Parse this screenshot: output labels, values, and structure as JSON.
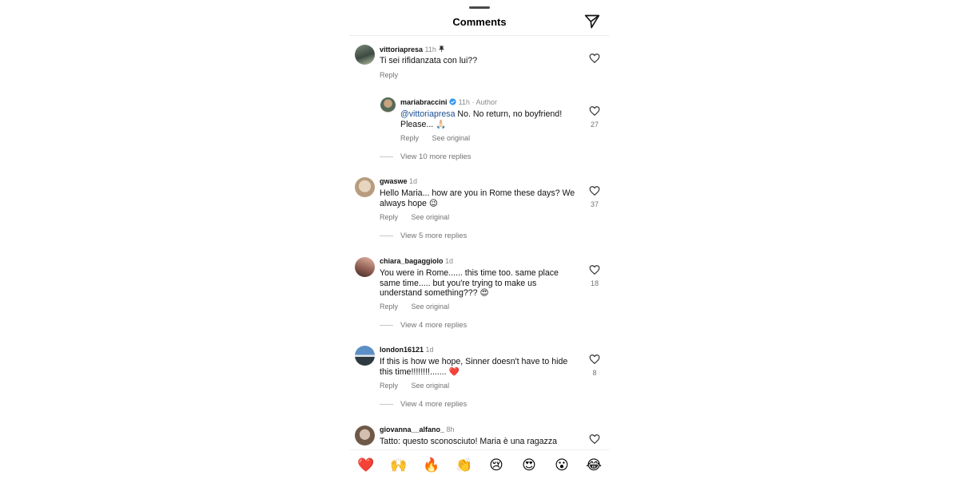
{
  "header": {
    "title": "Comments",
    "send_icon": "paper-plane-icon"
  },
  "comments": [
    {
      "user": "vittoriapresa",
      "time": "11h",
      "pinned": true,
      "text": "Ti sei rifidanzata con  lui??",
      "reply_label": "Reply"
    },
    {
      "user": "mariabraccini",
      "verified": true,
      "time": "11h",
      "author_label": "Author",
      "mention": "@vittoriapresa",
      "text": " No. No return, no boyfriend! Please... 🙏🏻",
      "reply_label": "Reply",
      "see_original_label": "See original",
      "likes": "27",
      "view_more": "View 10 more replies"
    },
    {
      "user": "gwaswe",
      "time": "1d",
      "text": "Hello Maria... how are you in Rome these days? We always hope 😉",
      "reply_label": "Reply",
      "see_original_label": "See original",
      "likes": "37",
      "view_more": "View 5 more replies"
    },
    {
      "user": "chiara_bagaggiolo",
      "time": "1d",
      "text": "You were in Rome...... this time too. same place same time..... but you're trying to make us understand something??? 😍",
      "reply_label": "Reply",
      "see_original_label": "See original",
      "likes": "18",
      "view_more": "View 4 more replies"
    },
    {
      "user": "london16121",
      "time": "1d",
      "text": "If this is how we hope, Sinner doesn't have to hide this time!!!!!!!!....... ❤️",
      "reply_label": "Reply",
      "see_original_label": "See original",
      "likes": "8",
      "view_more": "View 4 more replies"
    },
    {
      "user": "giovanna__alfano_",
      "time": "8h",
      "text": "Tatto: questo sconosciuto! Maria è una ragazza"
    }
  ],
  "emoji_bar": [
    "❤️",
    "🙌",
    "🔥",
    "👏",
    "😢",
    "😍",
    "😮",
    "😂"
  ],
  "colors": {
    "mention": "#1b4f91",
    "verified": "#3897f0",
    "heart": "#e0245e"
  }
}
